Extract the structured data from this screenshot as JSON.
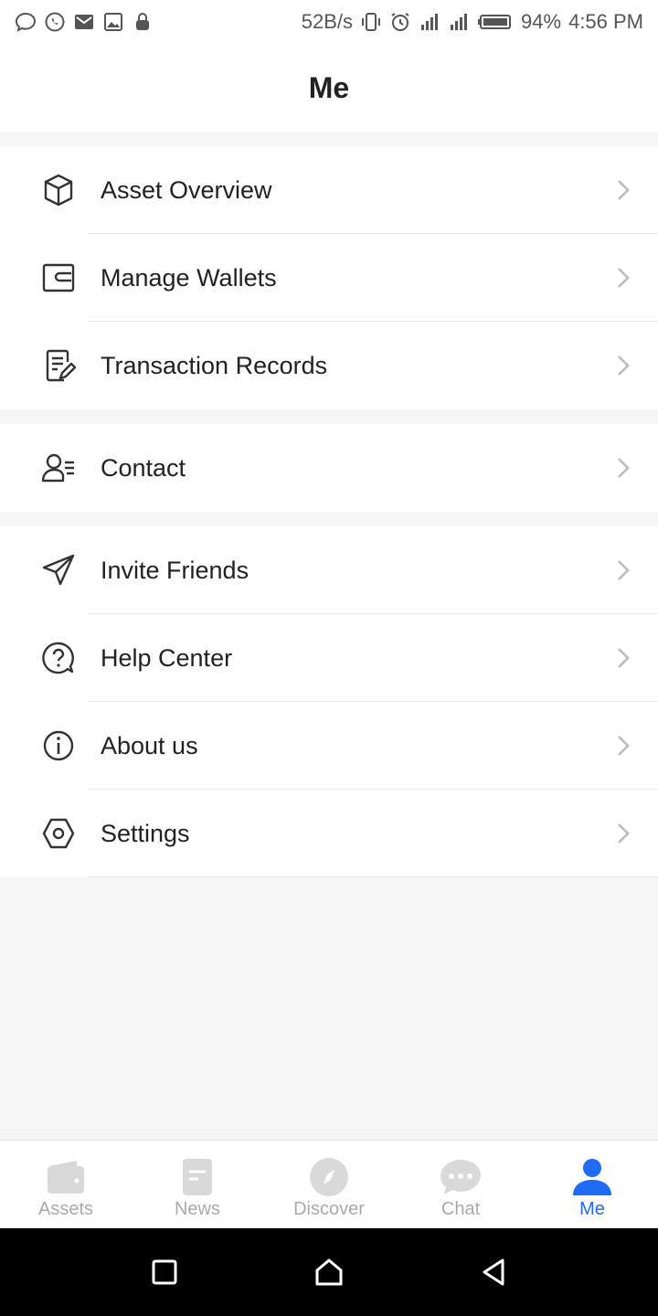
{
  "status_bar": {
    "net_speed": "52B/s",
    "battery": "94%",
    "time": "4:56 PM",
    "left_icons": [
      "chat-bubble-icon",
      "whatsapp-icon",
      "gmail-icon",
      "gallery-icon",
      "lock-icon"
    ],
    "right_icons": [
      "vibrate-icon",
      "alarm-icon",
      "signal-icon",
      "signal-icon",
      "battery-icon"
    ]
  },
  "header": {
    "title": "Me"
  },
  "menu": {
    "group1": [
      {
        "label": "Asset Overview",
        "icon": "cube-icon"
      },
      {
        "label": "Manage Wallets",
        "icon": "wallet-icon"
      },
      {
        "label": "Transaction Records",
        "icon": "records-icon"
      }
    ],
    "group2": [
      {
        "label": "Contact",
        "icon": "contact-icon"
      }
    ],
    "group3": [
      {
        "label": "Invite Friends",
        "icon": "paper-plane-icon"
      },
      {
        "label": "Help Center",
        "icon": "help-icon"
      },
      {
        "label": "About us",
        "icon": "info-icon"
      },
      {
        "label": "Settings",
        "icon": "settings-hexagon-icon"
      }
    ]
  },
  "tabs": [
    {
      "label": "Assets",
      "icon": "wallet-tab-icon",
      "active": false
    },
    {
      "label": "News",
      "icon": "news-tab-icon",
      "active": false
    },
    {
      "label": "Discover",
      "icon": "compass-tab-icon",
      "active": false
    },
    {
      "label": "Chat",
      "icon": "chat-tab-icon",
      "active": false
    },
    {
      "label": "Me",
      "icon": "person-tab-icon",
      "active": true
    }
  ],
  "colors": {
    "accent": "#1e6cf2",
    "inactive_tab": "#cfcfcf",
    "background": "#f5f5f5"
  }
}
